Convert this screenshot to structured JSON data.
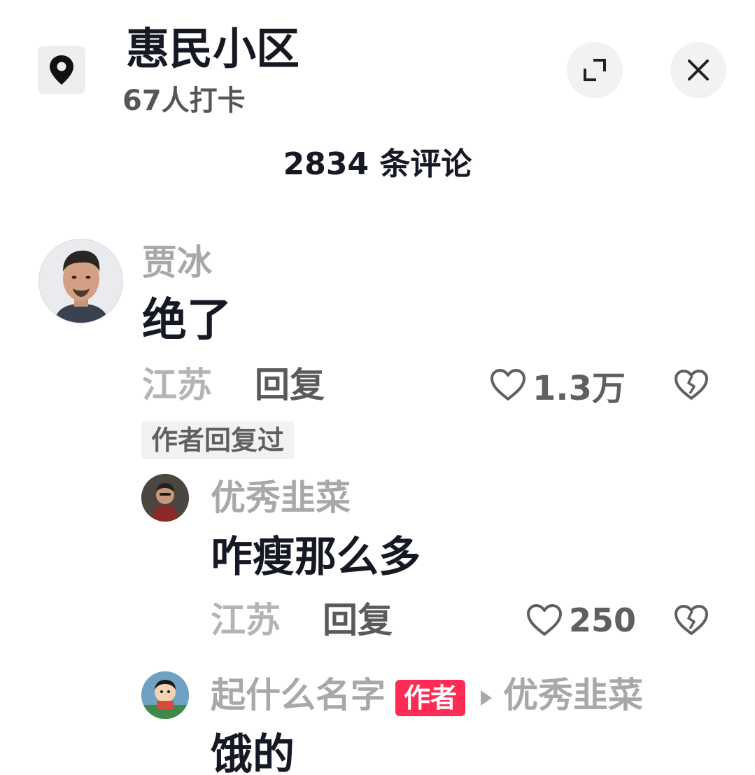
{
  "header": {
    "location_icon": "location-pin-icon",
    "title": "惠民小区",
    "checkin_text": "67人打卡",
    "expand_icon": "expand-icon",
    "close_icon": "close-icon"
  },
  "comment_count": "2834 条评论",
  "colors": {
    "author_badge": "#fe2c55",
    "text_primary": "#161823",
    "text_secondary": "#a8a8a8"
  },
  "comments": [
    {
      "username": "贾冰",
      "text": "绝了",
      "location": "江苏",
      "reply_label": "回复",
      "likes": "1.3万",
      "author_replied_label": "作者回复过",
      "replies": [
        {
          "username": "优秀韭菜",
          "text": "咋瘦那么多",
          "location": "江苏",
          "reply_label": "回复",
          "likes": "250"
        },
        {
          "username": "起什么名字",
          "badge": "作者",
          "reply_to": "优秀韭菜",
          "text": "饿的"
        }
      ]
    }
  ]
}
